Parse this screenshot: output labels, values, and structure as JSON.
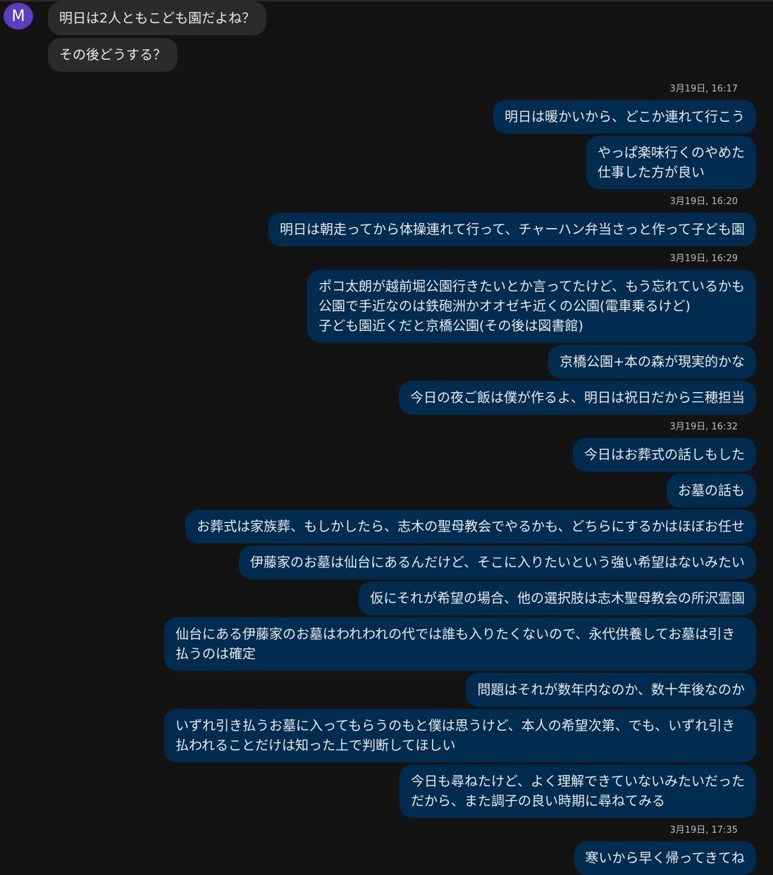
{
  "contact": {
    "avatar_letter": "M"
  },
  "incoming": [
    "明日は2人ともこども園だよね？",
    "その後どうする？"
  ],
  "outgoing": [
    {
      "timestamp": "3月19日, 16:17"
    },
    {
      "text": "明日は暖かいから、どこか連れて行こう"
    },
    {
      "text": "やっぱ楽味行くのやめた\n仕事した方が良い"
    },
    {
      "timestamp": "3月19日, 16:20"
    },
    {
      "text": "明日は朝走ってから体操連れて行って、チャーハン弁当さっと作って子ども園"
    },
    {
      "timestamp": "3月19日, 16:29"
    },
    {
      "text": "ポコ太朗が越前堀公園行きたいとか言ってたけど、もう忘れているかも\n公園で手近なのは鉄砲洲かオオゼキ近くの公園(電車乗るけど)\n子ども園近くだと京橋公園(その後は図書館)"
    },
    {
      "text": "京橋公園+本の森が現実的かな"
    },
    {
      "text": "今日の夜ご飯は僕が作るよ、明日は祝日だから三穂担当"
    },
    {
      "timestamp": "3月19日, 16:32"
    },
    {
      "text": "今日はお葬式の話しもした"
    },
    {
      "text": "お墓の話も"
    },
    {
      "text": "お葬式は家族葬、もしかしたら、志木の聖母教会でやるかも、どちらにするかはほぼお任せ"
    },
    {
      "text": "伊藤家のお墓は仙台にあるんだけど、そこに入りたいという強い希望はないみたい"
    },
    {
      "text": "仮にそれが希望の場合、他の選択肢は志木聖母教会の所沢霊園"
    },
    {
      "text": "仙台にある伊藤家のお墓はわれわれの代では誰も入りたくないので、永代供養してお墓は引き払うのは確定",
      "wide": true
    },
    {
      "text": "問題はそれが数年内なのか、数十年後なのか"
    },
    {
      "text": "いずれ引き払うお墓に入ってもらうのもと僕は思うけど、本人の希望次第、でも、いずれ引き払われることだけは知った上で判断してほしい",
      "wide": true
    },
    {
      "text": "今日も尋ねたけど、よく理解できていないみたいだった\nだから、また調子の良い時期に尋ねてみる"
    },
    {
      "timestamp": "3月19日, 17:35"
    },
    {
      "text": "寒いから早く帰ってきてね"
    }
  ]
}
